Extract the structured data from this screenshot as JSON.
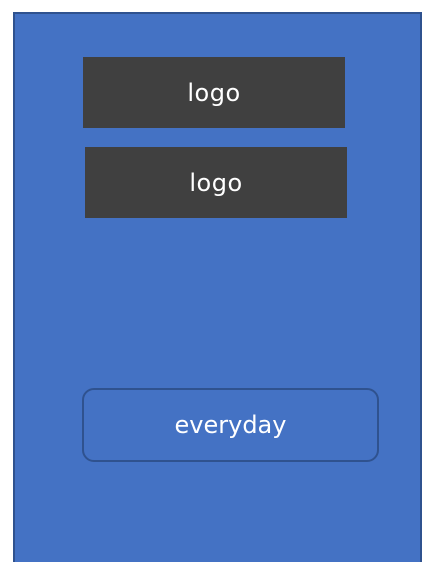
{
  "screen": {
    "logos": [
      {
        "label": "logo"
      },
      {
        "label": "logo"
      }
    ],
    "button": {
      "label": "everyday"
    }
  },
  "colors": {
    "background": "#4472c4",
    "border": "#2f528f",
    "logo_box": "#404040",
    "text": "#ffffff"
  }
}
